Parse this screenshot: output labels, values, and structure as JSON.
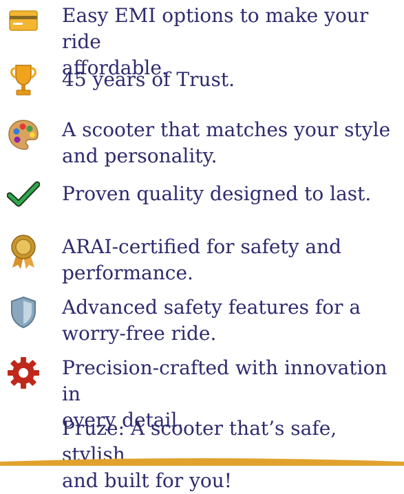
{
  "features": [
    {
      "icon": "credit-card-icon",
      "text": "Easy EMI options to make your ride\naffordable."
    },
    {
      "icon": "trophy-icon",
      "text": "45 years of Trust."
    },
    {
      "icon": "palette-icon",
      "text": "A scooter that matches your style\nand personality."
    },
    {
      "icon": "checkmark-icon",
      "text": "Proven quality designed to last."
    },
    {
      "icon": "medal-icon",
      "text": "ARAI-certified for safety and\n performance."
    },
    {
      "icon": "shield-icon",
      "text": "Advanced safety features for a\nworry-free ride."
    },
    {
      "icon": "gear-icon",
      "text": "Precision-crafted with innovation in\nevery detail."
    }
  ],
  "tagline": "Pruze: A scooter that’s safe, stylish,\nand built for you!",
  "colors": {
    "text": "#2d2a6e",
    "accent_gold": "#e0a22c",
    "check_green": "#2fa84f",
    "gear_red": "#c0281b"
  }
}
